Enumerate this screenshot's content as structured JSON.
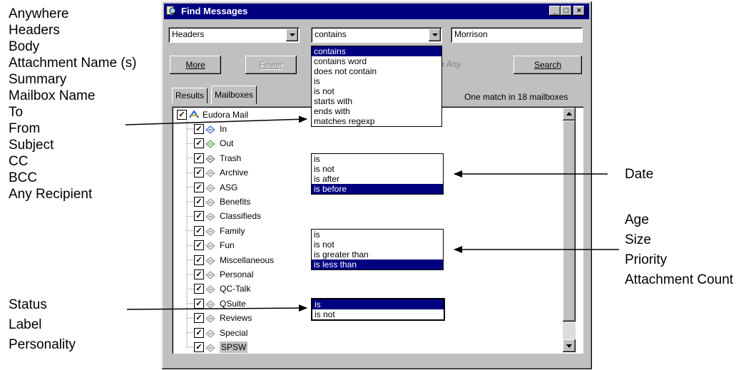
{
  "left_annotations_top": [
    "Anywhere",
    "Headers",
    "Body",
    "Attachment Name (s)",
    "Summary",
    "Mailbox Name",
    "To",
    "From",
    "Subject",
    "CC",
    "BCC",
    "Any Recipient"
  ],
  "left_annotations_bottom": [
    "Status",
    "Label",
    "Personality"
  ],
  "right_annotation_date": "Date",
  "right_annotations_numeric": [
    "Age",
    "Size",
    "Priority",
    "Attachment Count"
  ],
  "window": {
    "title": "Find Messages",
    "controls": [
      "minimize",
      "maximize",
      "close"
    ]
  },
  "criteria": {
    "field": "Headers",
    "operator": "contains",
    "value": "Morrison"
  },
  "buttons": {
    "more": "More",
    "fewer": "Fewer",
    "search": "Search",
    "match_any_partial": "h Any"
  },
  "tabs": [
    "Results",
    "Mailboxes"
  ],
  "status_text": "One match in 18 mailboxes",
  "tree": {
    "root": "Eudora Mail",
    "mailboxes": [
      "In",
      "Out",
      "Trash",
      "Archive",
      "ASG",
      "Benefits",
      "Classifieds",
      "Family",
      "Fun",
      "Miscellaneous",
      "Personal",
      "QC-Talk",
      "QSuite",
      "Reviews",
      "Special",
      "SPSW"
    ]
  },
  "operator_dropdown": {
    "options": [
      "contains",
      "contains word",
      "does not contain",
      "is",
      "is not",
      "starts with",
      "ends with",
      "matches regexp"
    ],
    "selected": "contains"
  },
  "date_list": {
    "options": [
      "is",
      "is not",
      "is after",
      "is before"
    ],
    "selected": "is before"
  },
  "numeric_list": {
    "options": [
      "is",
      "is not",
      "is greater than",
      "is less than"
    ],
    "selected": "is less than"
  },
  "status_list": {
    "options": [
      "is",
      "is not"
    ],
    "selected": "is"
  },
  "colors": {
    "titlebar": "#000080",
    "selection": "#000080",
    "chrome": "#c0c0c0"
  },
  "icons": {
    "window": "search-magnifier-icon",
    "root": "eudora-icon",
    "mailbox": "mailbox-icon"
  }
}
